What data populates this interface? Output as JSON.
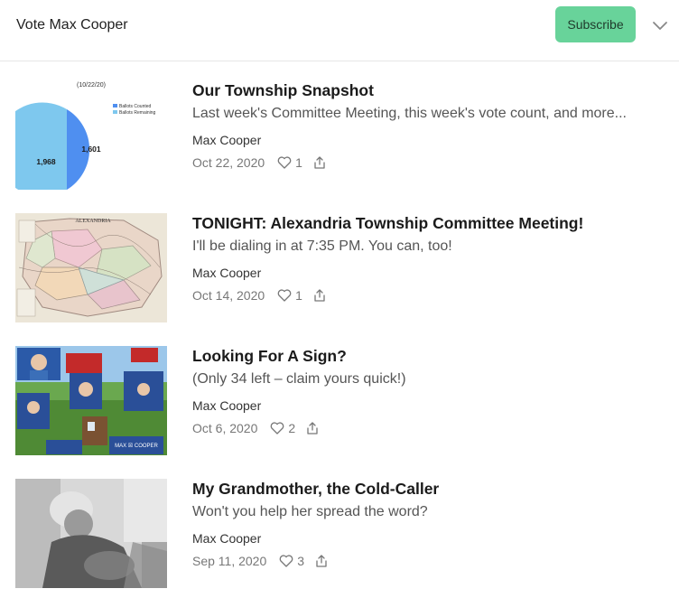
{
  "header": {
    "title": "Vote Max Cooper",
    "subscribe_label": "Subscribe"
  },
  "posts": [
    {
      "title": "Our Township Snapshot",
      "subtitle": "Last week's Committee Meeting, this week's vote count, and more...",
      "author": "Max Cooper",
      "date": "Oct 22, 2020",
      "likes": "1",
      "thumb": {
        "caption": "(10/22/20)",
        "legend": [
          "Ballots Counted",
          "Ballots Remaining"
        ],
        "values": [
          "1,601",
          "1,968"
        ]
      }
    },
    {
      "title": "TONIGHT: Alexandria Township Committee Meeting!",
      "subtitle": "I'll be dialing in at 7:35 PM. You can, too!",
      "author": "Max Cooper",
      "date": "Oct 14, 2020",
      "likes": "1",
      "thumb": {
        "map_label": "ALEXANDRIA"
      }
    },
    {
      "title": "Looking For A Sign?",
      "subtitle": "(Only 34 left – claim yours quick!)",
      "author": "Max Cooper",
      "date": "Oct 6, 2020",
      "likes": "2",
      "thumb": {
        "sign_text": "MAX ☒ COOPER"
      }
    },
    {
      "title": "My Grandmother, the Cold-Caller",
      "subtitle": "Won't you help her spread the word?",
      "author": "Max Cooper",
      "date": "Sep 11, 2020",
      "likes": "3"
    }
  ],
  "colors": {
    "subscribe_bg": "#68d39a",
    "pie_counted": "#4f8ff0",
    "pie_remaining": "#7ec8ee"
  },
  "icons": [
    "chevron-down-icon",
    "heart-icon",
    "share-icon"
  ]
}
